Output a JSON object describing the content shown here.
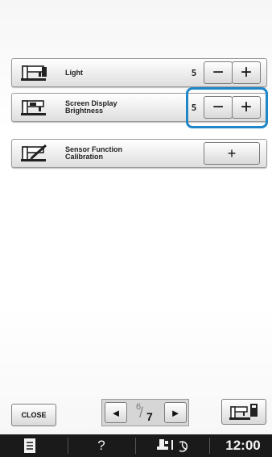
{
  "settings": [
    {
      "label": "Light",
      "value": "5",
      "control": "stepper",
      "icon": "machine-light-icon"
    },
    {
      "label": "Screen Display\nBrightness",
      "value": "5",
      "control": "stepper",
      "icon": "machine-screen-icon"
    },
    {
      "label": "Sensor Function\nCalibration",
      "value": "",
      "control": "button",
      "button_label": "+",
      "icon": "machine-sensor-pen-icon"
    }
  ],
  "stepper": {
    "minus_label": "−",
    "plus_label": "+"
  },
  "footer": {
    "close_label": "CLOSE",
    "page_current": "6",
    "page_total": "7",
    "prev_label": "◄",
    "next_label": "►"
  },
  "statusbar": {
    "help_label": "?",
    "time": "12:00"
  },
  "colors": {
    "highlight": "#1f86c8",
    "statusbar_bg": "#1a1a1a"
  }
}
